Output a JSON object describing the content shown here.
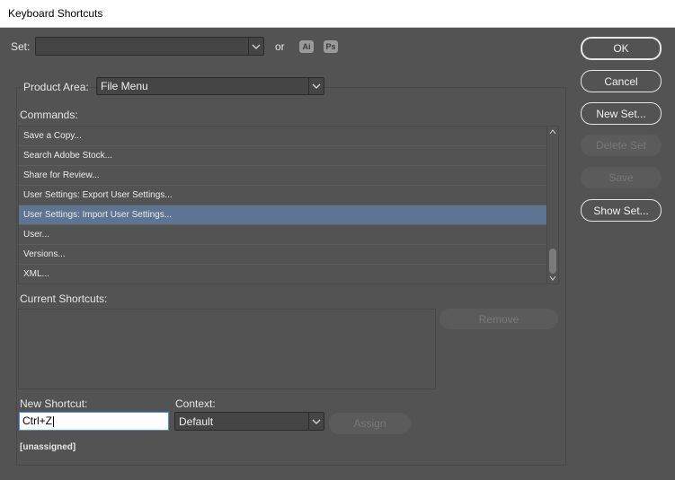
{
  "window": {
    "title": "Keyboard Shortcuts"
  },
  "set": {
    "label": "Set:",
    "value": "",
    "or_label": "or",
    "app_badges": [
      "Ai",
      "Ps"
    ]
  },
  "product_area": {
    "label": "Product Area:",
    "value": "File Menu"
  },
  "commands": {
    "label": "Commands:",
    "items": [
      "Save a Copy...",
      "Search Adobe Stock...",
      "Share for Review...",
      "User Settings: Export User Settings...",
      "User Settings: Import User Settings...",
      "User...",
      "Versions...",
      "XML..."
    ],
    "selected_index": 4
  },
  "current_shortcuts": {
    "label": "Current Shortcuts:",
    "remove_label": "Remove"
  },
  "new_shortcut": {
    "label": "New Shortcut:",
    "value": "Ctrl+Z",
    "status": "[unassigned]"
  },
  "context": {
    "label": "Context:",
    "value": "Default"
  },
  "assign": {
    "label": "Assign"
  },
  "buttons": {
    "ok": "OK",
    "cancel": "Cancel",
    "new_set": "New Set...",
    "delete_set": "Delete Set",
    "save": "Save",
    "show_set": "Show Set..."
  },
  "colors": {
    "background": "#535353",
    "selection": "#5d7592",
    "input_focus": "#4a90e2"
  }
}
